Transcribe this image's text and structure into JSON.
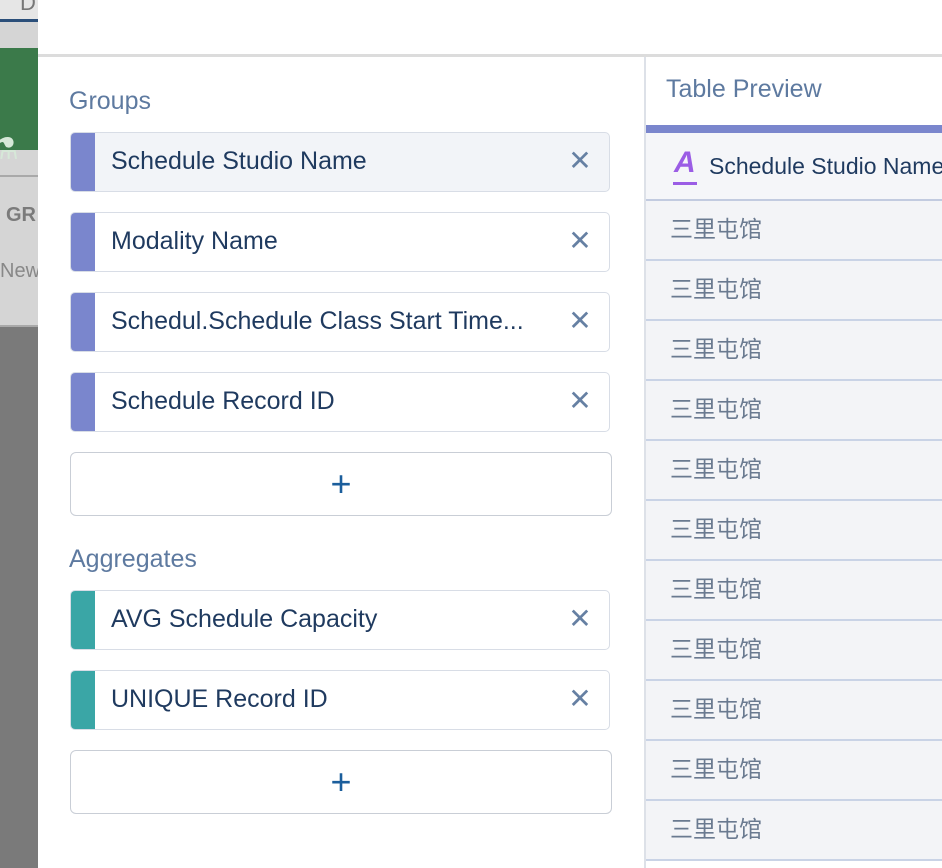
{
  "background": {
    "top_text": "D",
    "gr_text": "GR",
    "new_text": "New"
  },
  "groups": {
    "title": "Groups",
    "items": [
      {
        "label": "Schedule Studio Name",
        "remove_icon": "close-icon"
      },
      {
        "label": "Modality Name",
        "remove_icon": "close-icon"
      },
      {
        "label": "Schedul.Schedule Class Start Time...",
        "remove_icon": "close-icon"
      },
      {
        "label": "Schedule Record ID",
        "remove_icon": "close-icon"
      }
    ],
    "add_label": "+"
  },
  "aggregates": {
    "title": "Aggregates",
    "items": [
      {
        "label": "AVG Schedule Capacity",
        "remove_icon": "close-icon"
      },
      {
        "label": "UNIQUE Record ID",
        "remove_icon": "close-icon"
      }
    ],
    "add_label": "+"
  },
  "preview": {
    "title": "Table Preview",
    "column": {
      "type_icon": "A",
      "header": "Schedule Studio Name"
    },
    "rows": [
      "三里屯馆",
      "三里屯馆",
      "三里屯馆",
      "三里屯馆",
      "三里屯馆",
      "三里屯馆",
      "三里屯馆",
      "三里屯馆",
      "三里屯馆",
      "三里屯馆",
      "三里屯馆"
    ]
  },
  "colors": {
    "group_accent": "#7a86cd",
    "aggregate_accent": "#3aa6a6",
    "text_primary": "#1f3a5f",
    "section_title": "#5e7aa0",
    "text_type_icon": "#9b5de5"
  }
}
